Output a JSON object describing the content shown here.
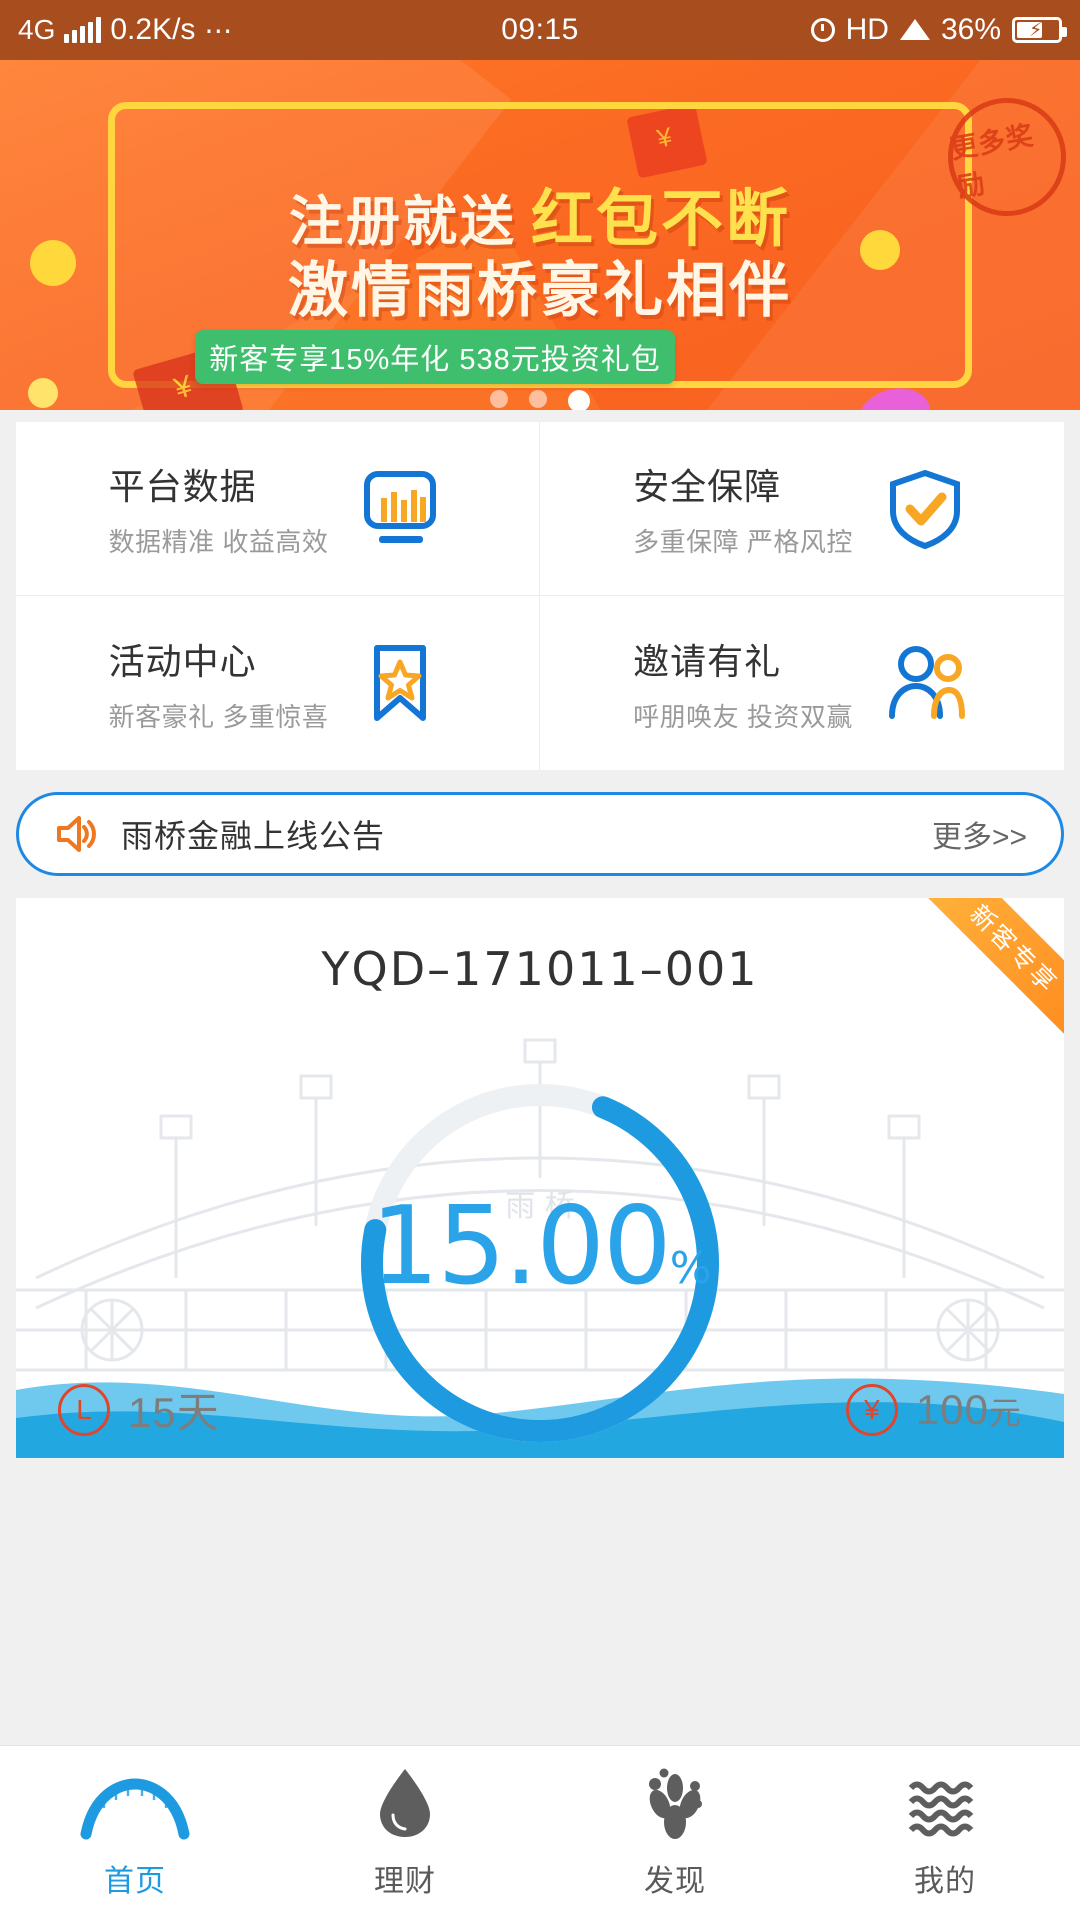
{
  "statusbar": {
    "network": "4G",
    "speed": "0.2K/s",
    "more_dots": "⋯",
    "time": "09:15",
    "hd": "HD",
    "battery_pct": "36%",
    "icons": [
      "signal-bars-icon",
      "alarm-clock-icon",
      "wifi-icon",
      "battery-charging-icon"
    ]
  },
  "banner": {
    "title_white": "注册就送",
    "title_yellow": "红包不断",
    "title_line2": "激情雨桥豪礼相伴",
    "pill": "新客专享15%年化 538元投资礼包",
    "stamp": "更多奖励",
    "dot_count": 3,
    "active_dot": 3,
    "bg_color": "#fb6a22",
    "frame_color": "#ffd540",
    "pill_color": "#3fbf6e",
    "stamp_color": "#d93a14"
  },
  "features": [
    {
      "title": "平台数据",
      "sub": "数据精准 收益高效",
      "icon": "bar-chart-icon"
    },
    {
      "title": "安全保障",
      "sub": "多重保障 严格风控",
      "icon": "shield-check-icon"
    },
    {
      "title": "活动中心",
      "sub": "新客豪礼 多重惊喜",
      "icon": "bookmark-star-icon"
    },
    {
      "title": "邀请有礼",
      "sub": "呼朋唤友 投资双赢",
      "icon": "invite-people-icon"
    }
  ],
  "notice": {
    "icon": "speaker-icon",
    "text": "雨桥金融上线公告",
    "more": "更多>>",
    "border_color": "#1e88e5"
  },
  "product": {
    "ribbon": "新客专享",
    "code": "YQD–171011–001",
    "rate": "15.00",
    "rate_unit": "%",
    "term_icon": "clock-circle-icon",
    "term": "15天",
    "amount_icon": "yuan-circle-icon",
    "amount_value": "100",
    "amount_unit": "元",
    "watermark": "雨桥",
    "accent_color": "#1e9ae0",
    "ribbon_color": "#ff8a1e",
    "progress_pct": 72
  },
  "tabbar": {
    "items": [
      {
        "label": "首页",
        "icon": "bridge-icon",
        "active": true
      },
      {
        "label": "理财",
        "icon": "droplet-icon",
        "active": false
      },
      {
        "label": "发现",
        "icon": "plant-icon",
        "active": false
      },
      {
        "label": "我的",
        "icon": "waves-icon",
        "active": false
      }
    ]
  }
}
